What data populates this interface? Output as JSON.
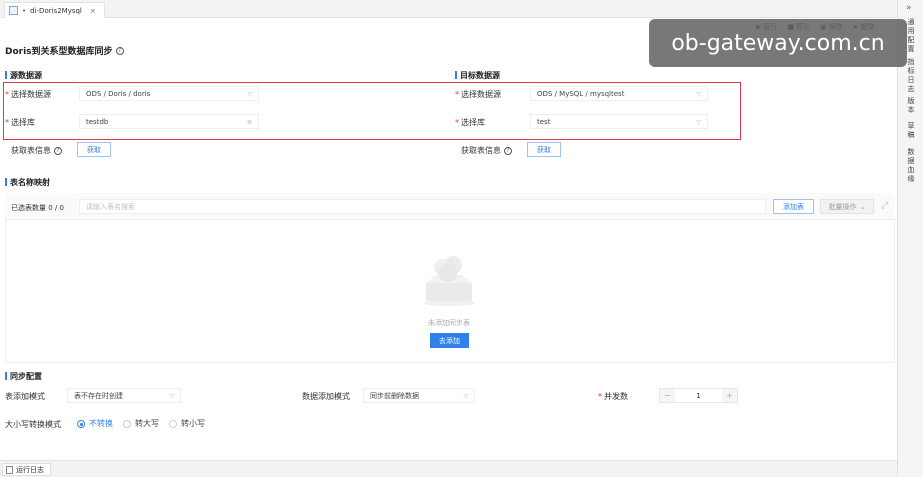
{
  "tab": {
    "title": "di-Doris2Mysql",
    "modified": "•",
    "close": "×"
  },
  "toolbar": {
    "run": "运行",
    "stop": "停止",
    "save": "保存",
    "submit": "提交"
  },
  "rightbar": {
    "collapse": "»",
    "items": [
      "通用配置",
      "指标日志",
      "版本",
      "草稿",
      "数据血缘"
    ]
  },
  "page_title": "Doris到关系型数据库同步",
  "source": {
    "section": "源数据源",
    "ds_label": "选择数据源",
    "ds_value": "ODS / Doris / doris",
    "db_label": "选择库",
    "db_value": "testdb",
    "fetch_label": "获取表信息",
    "fetch_button": "获取"
  },
  "target": {
    "section": "目标数据源",
    "ds_label": "选择数据源",
    "ds_value": "ODS / MySQL / mysqltest",
    "db_label": "选择库",
    "db_value": "test",
    "fetch_label": "获取表信息",
    "fetch_button": "获取"
  },
  "mapping": {
    "section": "表名称映射",
    "selected_count": "已选表数量 0 / 0",
    "search_placeholder": "请输入表名搜索",
    "add_table": "添加表",
    "batch_ops": "批量操作",
    "empty_text": "未添加同步表",
    "go_add": "去添加"
  },
  "sync": {
    "section": "同步配置",
    "table_mode_label": "表添加模式",
    "table_mode_value": "表不存在时创建",
    "data_mode_label": "数据添加模式",
    "data_mode_value": "同步前删除数据",
    "concurrency_label": "并发数",
    "concurrency_value": "1",
    "minus": "−",
    "plus": "+",
    "case_label": "大小写转换模式",
    "case_options": [
      "不转换",
      "转大写",
      "转小写"
    ]
  },
  "bottom": {
    "log_tab": "运行日志"
  },
  "watermark": "ob-gateway.com.cn"
}
